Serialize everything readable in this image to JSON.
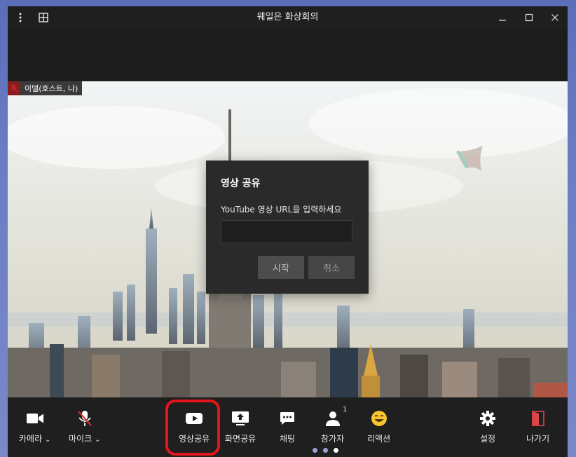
{
  "window": {
    "title": "웨일은 화상회의"
  },
  "participant_tag": {
    "name": "이델(호스트, 나)"
  },
  "dialog": {
    "title": "영상 공유",
    "prompt": "YouTube 영상 URL을 입력하세요",
    "url_value": "",
    "start_label": "시작",
    "cancel_label": "취소"
  },
  "toolbar": {
    "camera_label": "카메라",
    "mic_label": "마이크",
    "video_share_label": "영상공유",
    "screen_share_label": "화면공유",
    "chat_label": "채팅",
    "participants_label": "참가자",
    "participants_count": "1",
    "reaction_label": "리액션",
    "settings_label": "설정",
    "leave_label": "나가기"
  },
  "colors": {
    "highlight": "#e5151c",
    "leave": "#e0434a",
    "mic_off": "#c62828"
  }
}
